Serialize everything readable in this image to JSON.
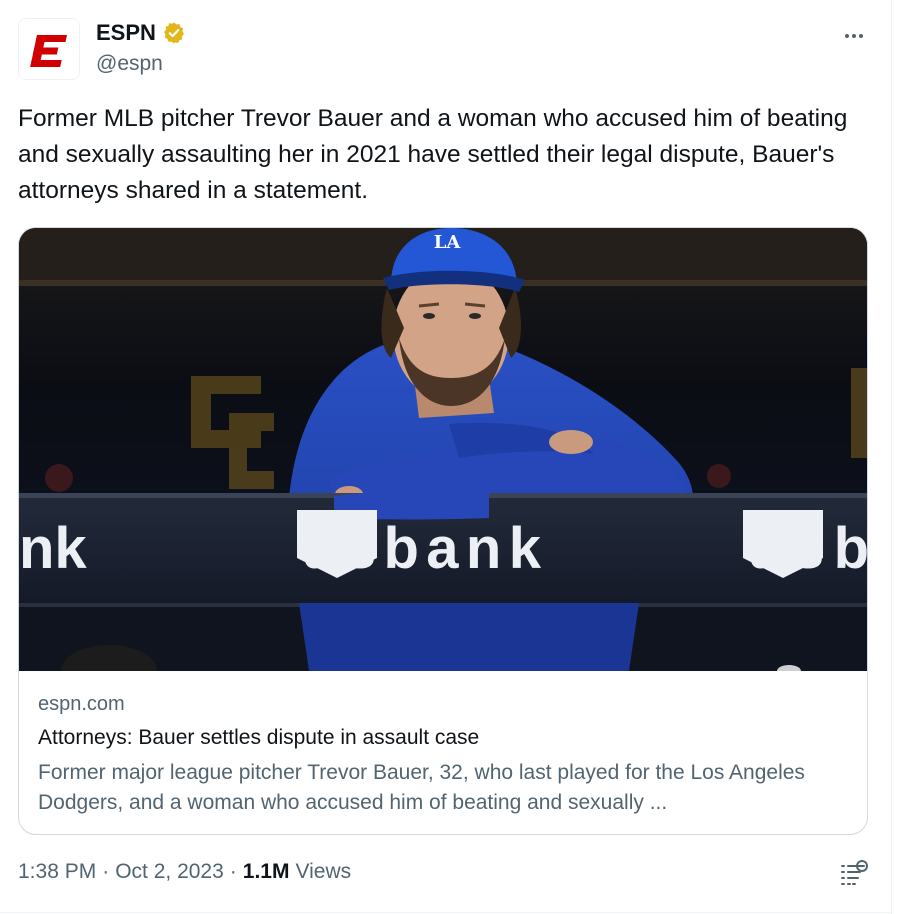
{
  "author": {
    "display_name": "ESPN",
    "handle": "@espn",
    "verified_icon": "verified-badge-icon",
    "logo_letter": "E"
  },
  "tweet": {
    "text": "Former MLB pitcher Trevor Bauer and a woman who accused him of beating and sexually assaulting her in 2021 have settled their legal dispute, Bauer's attorneys shared in a statement."
  },
  "card": {
    "image_signage_left": "nk",
    "image_signage_center": "usbank",
    "image_signage_right": "usb",
    "domain": "espn.com",
    "title": "Attorneys: Bauer settles dispute in assault case",
    "description": "Former major league pitcher Trevor Bauer, 32, who last played for the Los Angeles Dodgers, and a woman who accused him of beating and sexually ..."
  },
  "meta": {
    "time": "1:38 PM",
    "date": "Oct 2, 2023",
    "views_count": "1.1M",
    "views_label": "Views",
    "separator": "·"
  },
  "colors": {
    "espn_red": "#d00000",
    "verified_gold": "#e2b719",
    "text_primary": "#0f1419",
    "text_secondary": "#536471",
    "border": "#cfd9de"
  }
}
